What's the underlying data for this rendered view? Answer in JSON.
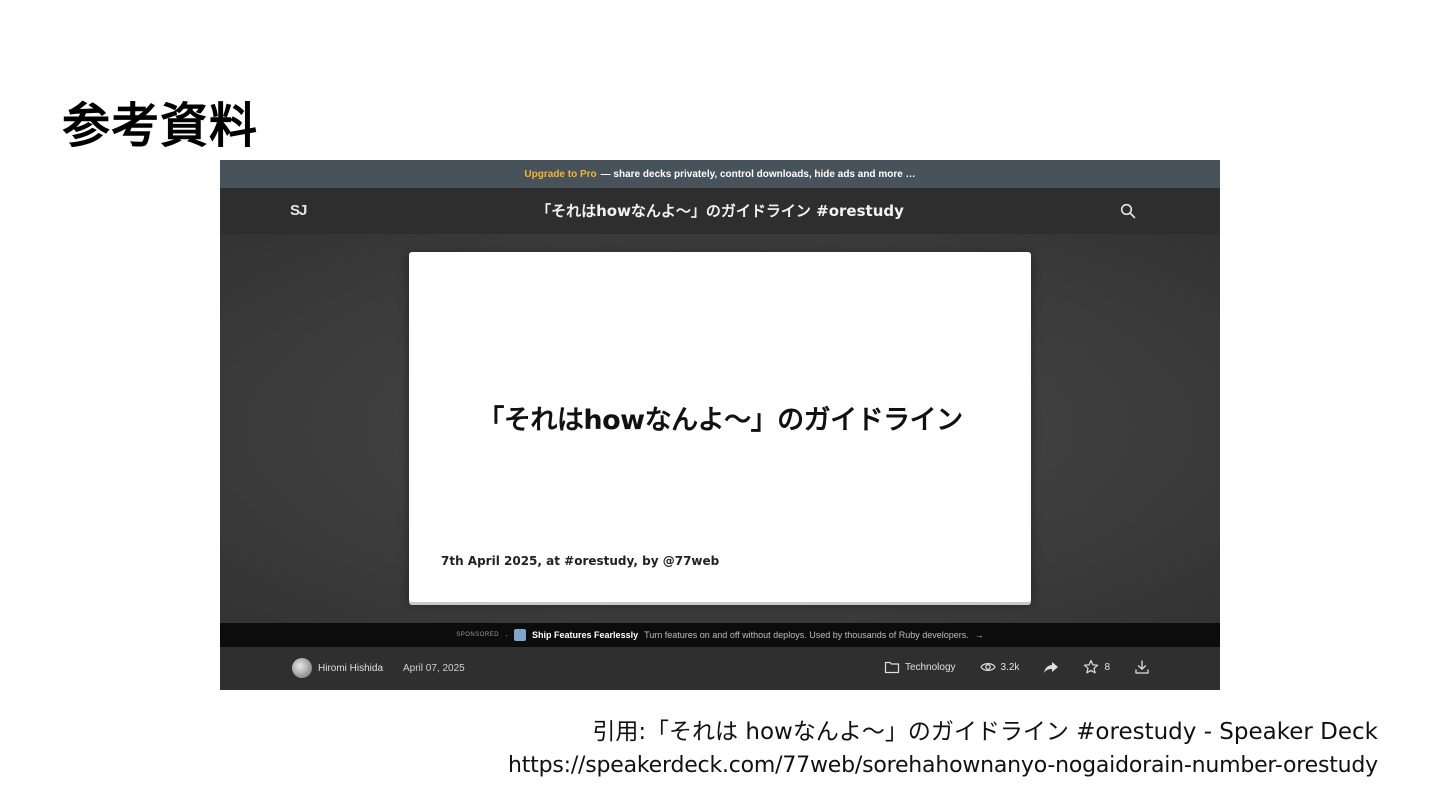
{
  "page": {
    "title": "参考資料"
  },
  "screenshot": {
    "promo": {
      "accent": "Upgrade to Pro",
      "text": "— share decks privately, control downloads, hide ads and more …"
    },
    "header": {
      "logo": "SJ",
      "deck_title": "「それはhowなんよ〜」のガイドライン #orestudy",
      "search_icon": "search-icon"
    },
    "slide": {
      "title": "「それはhowなんよ〜」のガイドライン",
      "footer": "7th April 2025, at #orestudy, by @77web"
    },
    "sponsor": {
      "label": "SPONSORED",
      "separator": "·",
      "name": "Ship Features Fearlessly",
      "description": "Turn features on and off without deploys. Used by thousands of Ruby developers.",
      "arrow": "→"
    },
    "meta": {
      "author": "Hiromi Hishida",
      "date": "April 07, 2025",
      "category": "Technology",
      "views": "3.2k",
      "stars": "8"
    },
    "colors": {
      "promo_bg": "#48525a",
      "promo_accent": "#f2b632",
      "header_bg": "#2e2e2e",
      "stage_bg": "#3d3d3d",
      "sponsor_bg": "#0c0c0c"
    }
  },
  "citation": {
    "line1": "引用:「それは howなんよ〜」のガイドライン  #orestudy - Speaker Deck",
    "line2": "https://speakerdeck.com/77web/sorehahownanyo-nogaidorain-number-orestudy"
  }
}
